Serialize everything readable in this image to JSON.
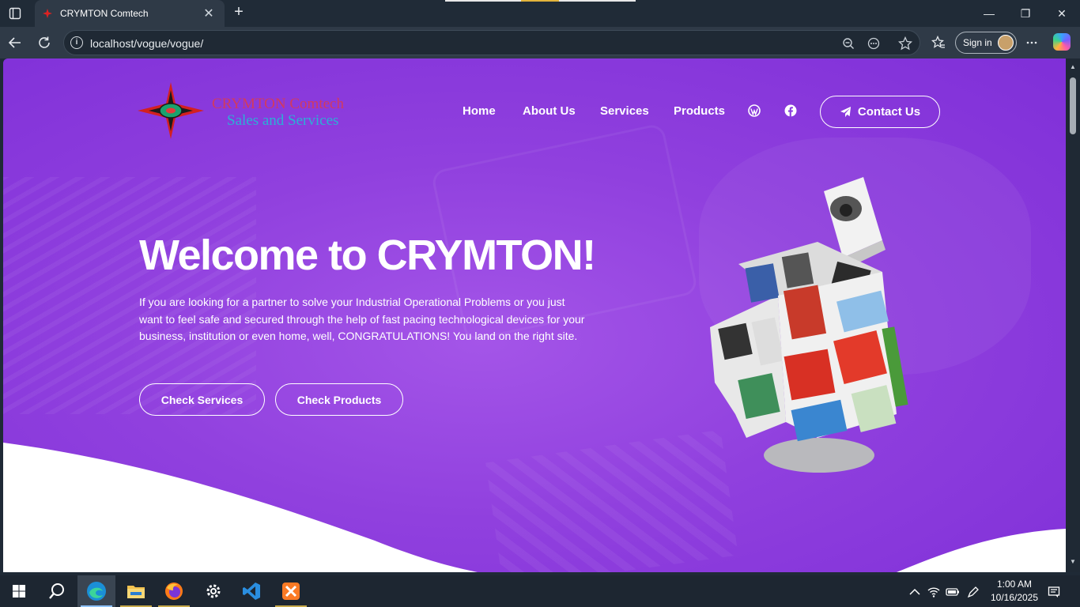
{
  "browser": {
    "tab_title": "CRYMTON Comtech",
    "tab_close": "✕",
    "new_tab": "+",
    "url": "localhost/vogue/vogue/",
    "sign_in": "Sign in",
    "window_controls": {
      "minimize": "—",
      "restore": "❐",
      "close": "✕"
    }
  },
  "site": {
    "logo": {
      "line1": "CRYMTON Comtech",
      "line2": "Sales and Services"
    },
    "nav": [
      "Home",
      "About Us",
      "Services",
      "Products"
    ],
    "social_icons": [
      "wordpress-icon",
      "facebook-icon"
    ],
    "contact_label": "Contact Us",
    "hero": {
      "title": "Welcome to CRYMTON!",
      "text": "If you are looking for a partner to solve your Industrial Operational Problems or you just want to feel safe and secured through the help of fast pacing technological devices for your business, institution or even home, well, CONGRATULATIONS! You land on the right site.",
      "buttons": [
        "Check Services",
        "Check Products"
      ]
    }
  },
  "taskbar": {
    "apps": [
      "start-icon",
      "search-icon",
      "edge-icon",
      "file-explorer-icon",
      "firefox-icon",
      "settings-icon",
      "vscode-icon",
      "xampp-icon"
    ],
    "time": "1:00 AM",
    "date": "10/16/2025"
  },
  "colors": {
    "page_purple": "#8a3ae0",
    "tab_bar": "#202b37",
    "toolbar": "#2f3a47"
  }
}
